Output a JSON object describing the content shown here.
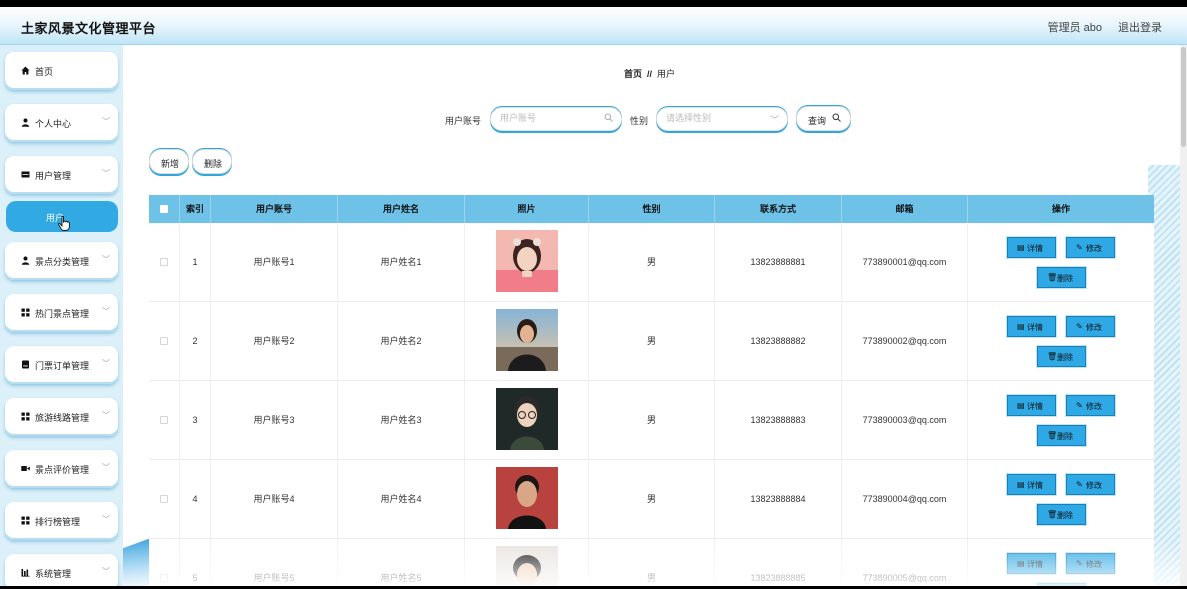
{
  "header": {
    "title": "土家风景文化管理平台",
    "admin": "管理员 abo",
    "logout": "退出登录"
  },
  "sidebar": {
    "items": [
      {
        "label": "首页",
        "icon": "home-icon",
        "chevron": false
      },
      {
        "label": "个人中心",
        "icon": "user-icon",
        "chevron": true
      },
      {
        "label": "用户管理",
        "icon": "card-icon",
        "chevron": true
      },
      {
        "label": "景点分类管理",
        "icon": "user-icon",
        "chevron": true
      },
      {
        "label": "热门景点管理",
        "icon": "grid-icon",
        "chevron": true
      },
      {
        "label": "门票订单管理",
        "icon": "ticket-icon",
        "chevron": true
      },
      {
        "label": "旅游线路管理",
        "icon": "grid-icon",
        "chevron": true
      },
      {
        "label": "景点评价管理",
        "icon": "video-icon",
        "chevron": true
      },
      {
        "label": "排行榜管理",
        "icon": "grid-icon",
        "chevron": true
      },
      {
        "label": "系统管理",
        "icon": "chart-icon",
        "chevron": true
      }
    ],
    "active_sub": "用户"
  },
  "breadcrumb": {
    "home": "首页",
    "sep": "//",
    "current": "用户"
  },
  "search": {
    "account_label": "用户账号",
    "account_placeholder": "用户账号",
    "gender_label": "性别",
    "gender_placeholder": "请选择性别",
    "query_button": "查询"
  },
  "actions": {
    "add": "新增",
    "delete": "删除"
  },
  "table": {
    "columns": [
      "索引",
      "用户账号",
      "用户姓名",
      "照片",
      "性别",
      "联系方式",
      "邮箱",
      "操作"
    ],
    "rows": [
      {
        "index": "1",
        "account": "用户账号1",
        "name": "用户姓名1",
        "gender": "男",
        "phone": "13823888881",
        "email": "773890001@qq.com"
      },
      {
        "index": "2",
        "account": "用户账号2",
        "name": "用户姓名2",
        "gender": "男",
        "phone": "13823888882",
        "email": "773890002@qq.com"
      },
      {
        "index": "3",
        "account": "用户账号3",
        "name": "用户姓名3",
        "gender": "男",
        "phone": "13823888883",
        "email": "773890003@qq.com"
      },
      {
        "index": "4",
        "account": "用户账号4",
        "name": "用户姓名4",
        "gender": "男",
        "phone": "13823888884",
        "email": "773890004@qq.com"
      },
      {
        "index": "5",
        "account": "用户账号5",
        "name": "用户姓名5",
        "gender": "男",
        "phone": "13823888885",
        "email": "773890005@qq.com"
      }
    ],
    "op_labels": {
      "detail": "详情",
      "edit": "修改",
      "delete": "删除"
    }
  },
  "colors": {
    "accent": "#2ea9e6",
    "header_row": "#6ec2e8",
    "sidebar_bg": "#dcf0f9"
  }
}
